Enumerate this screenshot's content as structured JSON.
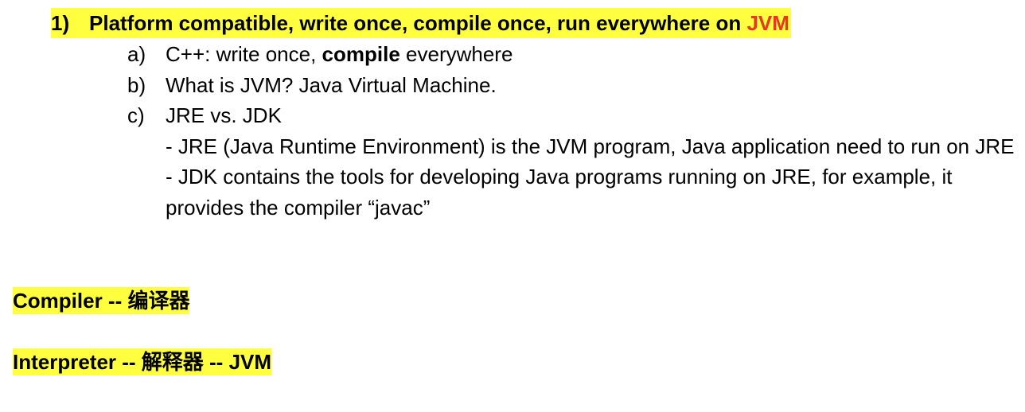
{
  "heading": {
    "number": "1)",
    "text": "Platform compatible, write once, compile once, run everywhere on ",
    "highlight_word": "JVM",
    "highlight_color": "#e8361f",
    "background_color": "#ffff3f"
  },
  "sub_items": [
    {
      "letter": "a)",
      "text_before": "C++: write once, ",
      "bold_word": "compile",
      "text_after": " everywhere"
    },
    {
      "letter": "b)",
      "text": "What is JVM? Java Virtual Machine."
    },
    {
      "letter": "c)",
      "text": "JRE vs. JDK",
      "notes": [
        "- JRE (Java Runtime Environment) is the JVM program, Java application need to run on JRE",
        "- JDK contains the tools for developing Java programs running on JRE, for example, it provides the compiler “javac”"
      ]
    }
  ],
  "terms": {
    "compiler": "Compiler -- 编译器",
    "interpreter": "Interpreter -- 解释器 -- JVM"
  }
}
